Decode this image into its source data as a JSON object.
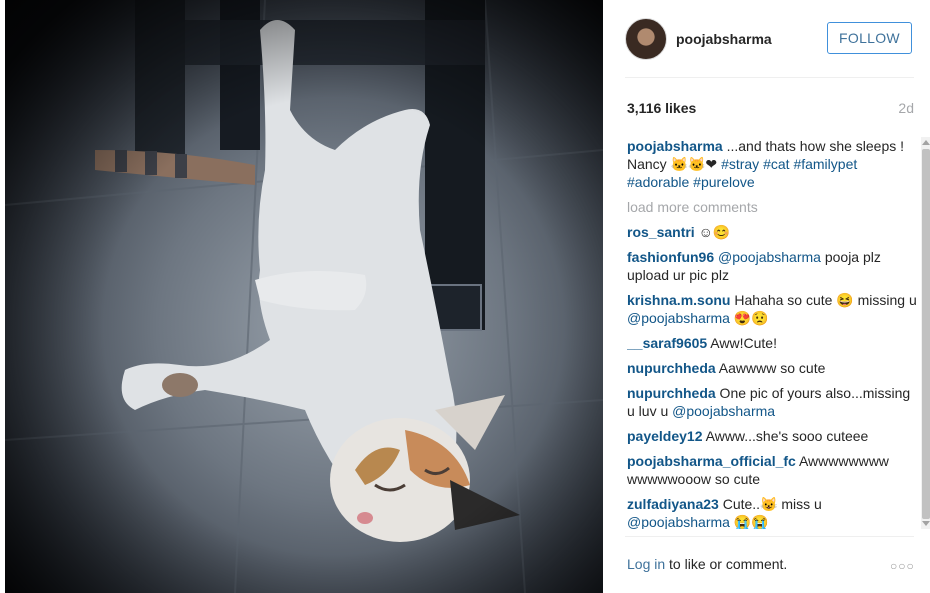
{
  "post": {
    "username": "poojabsharma",
    "follow_label": "FOLLOW",
    "likes": "3,116 likes",
    "time": "2d",
    "caption": {
      "username": "poojabsharma",
      "text": " ...and thats how she sleeps ! Nancy 🐱🐱❤ ",
      "hashtags": [
        "#stray",
        "#cat",
        "#familypet",
        "#adorable",
        "#purelove"
      ]
    },
    "load_more": "load more comments",
    "comments": [
      {
        "user": "ros_santri",
        "pre": " ☺😊",
        "mention": "",
        "post": ""
      },
      {
        "user": "fashionfun96",
        "pre": " ",
        "mention": "@poojabsharma",
        "post": " pooja plz upload ur pic plz"
      },
      {
        "user": "krishna.m.sonu",
        "pre": " Hahaha so cute 😆 missing u ",
        "mention": "@poojabsharma",
        "post": " 😍😟"
      },
      {
        "user": "__saraf9605",
        "pre": " Aww!Cute!",
        "mention": "",
        "post": ""
      },
      {
        "user": "nupurchheda",
        "pre": " Aawwww so cute",
        "mention": "",
        "post": ""
      },
      {
        "user": "nupurchheda",
        "pre": " One pic of yours also...missing u luv u ",
        "mention": "@poojabsharma",
        "post": ""
      },
      {
        "user": "payeldey12",
        "pre": " Awww...she's sooo cuteee",
        "mention": "",
        "post": ""
      },
      {
        "user": "poojabsharma_official_fc",
        "pre": " Awwwwwwww wwwwwooow so cute",
        "mention": "",
        "post": ""
      },
      {
        "user": "zulfadiyana23",
        "pre": " Cute..😺 miss u ",
        "mention": "@poojabsharma",
        "post": " 😭😭"
      }
    ],
    "footer": {
      "login": "Log in",
      "rest": " to like or comment."
    },
    "more_icon": "ellipsis-icon"
  }
}
